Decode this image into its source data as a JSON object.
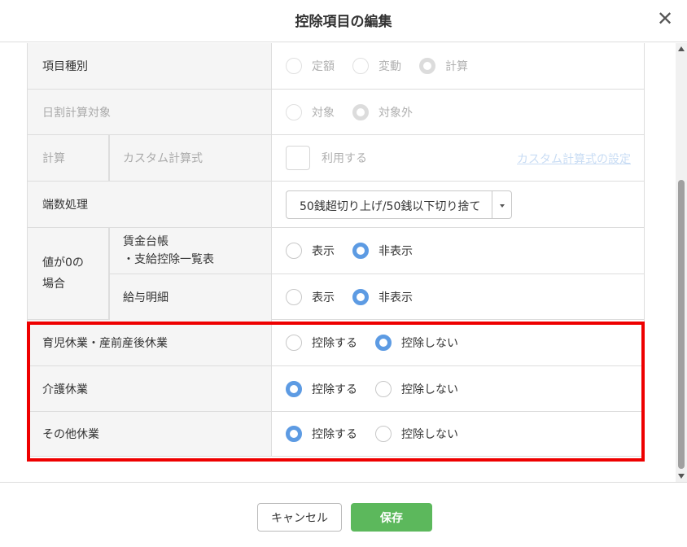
{
  "dialog": {
    "title": "控除項目の編集",
    "close_icon": "close-icon"
  },
  "rows": {
    "item_type": {
      "label": "項目種別",
      "options": [
        "定額",
        "変動",
        "計算"
      ],
      "selected": "計算",
      "disabled": true
    },
    "daily_calc": {
      "label": "日割計算対象",
      "options": [
        "対象",
        "対象外"
      ],
      "selected": "対象外",
      "disabled": true
    },
    "calculation": {
      "label": "計算",
      "sub_label": "カスタム計算式",
      "checkbox_label": "利用する",
      "link_label": "カスタム計算式の設定"
    },
    "rounding": {
      "label": "端数処理",
      "selected_value": "50銭超切り上げ/50銭以下切り捨て"
    },
    "zero_value": {
      "label": "値が0の場合",
      "ledger": {
        "label_line1": "賃金台帳",
        "label_line2": "・支給控除一覧表",
        "options": [
          "表示",
          "非表示"
        ],
        "selected": "非表示"
      },
      "payslip": {
        "label": "給与明細",
        "options": [
          "表示",
          "非表示"
        ],
        "selected": "非表示"
      }
    },
    "childcare_leave": {
      "label": "育児休業・産前産後休業",
      "options": [
        "控除する",
        "控除しない"
      ],
      "selected": "控除しない"
    },
    "nursing_leave": {
      "label": "介護休業",
      "options": [
        "控除する",
        "控除しない"
      ],
      "selected": "控除する"
    },
    "other_leave": {
      "label": "その他休業",
      "options": [
        "控除する",
        "控除しない"
      ],
      "selected": "控除する"
    }
  },
  "footer": {
    "cancel_label": "キャンセル",
    "save_label": "保存"
  },
  "colors": {
    "radio_selected": "#5d9be3",
    "save_button": "#5cb85c",
    "highlight_border": "#ee0000"
  }
}
